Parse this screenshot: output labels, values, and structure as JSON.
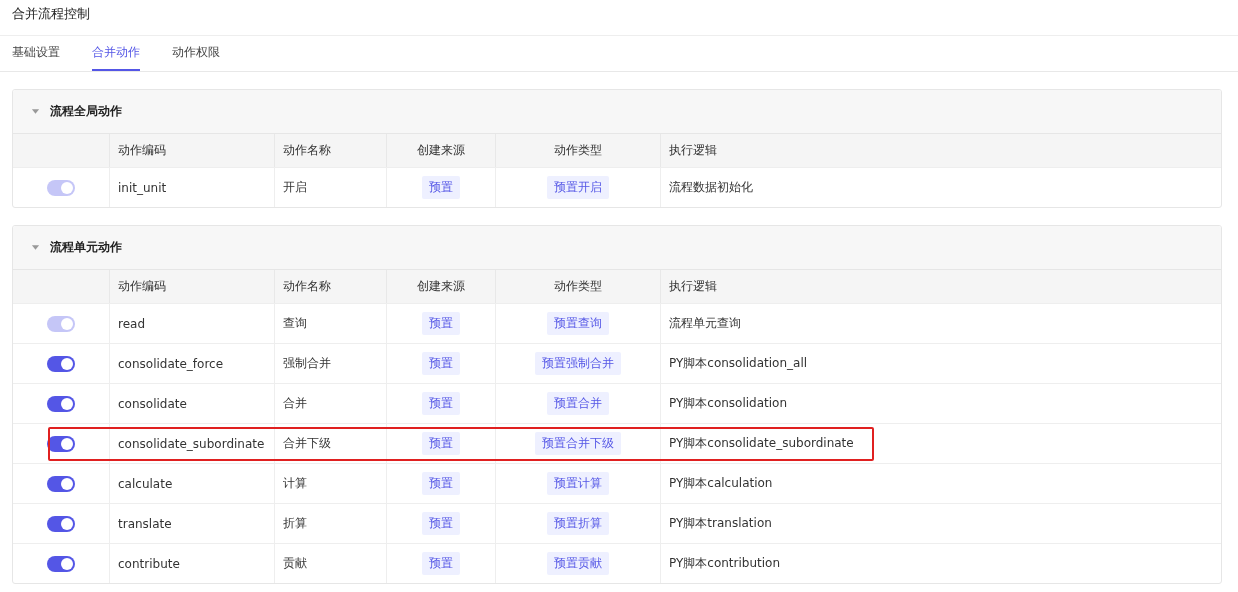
{
  "page_title": "合并流程控制",
  "tabs": [
    {
      "label": "基础设置",
      "selected": false
    },
    {
      "label": "合并动作",
      "selected": true
    },
    {
      "label": "动作权限",
      "selected": false
    }
  ],
  "sections": [
    {
      "title": "流程全局动作",
      "expanded": true,
      "columns": [
        "动作编码",
        "动作名称",
        "创建来源",
        "动作类型",
        "执行逻辑"
      ],
      "rows": [
        {
          "on": true,
          "disabled": true,
          "highlighted": false,
          "code": "init_unit",
          "name": "开启",
          "source": "预置",
          "type": "预置开启",
          "logic": "流程数据初始化"
        }
      ]
    },
    {
      "title": "流程单元动作",
      "expanded": true,
      "columns": [
        "动作编码",
        "动作名称",
        "创建来源",
        "动作类型",
        "执行逻辑"
      ],
      "rows": [
        {
          "on": true,
          "disabled": true,
          "highlighted": false,
          "code": "read",
          "name": "查询",
          "source": "预置",
          "type": "预置查询",
          "logic": "流程单元查询"
        },
        {
          "on": true,
          "disabled": false,
          "highlighted": false,
          "code": "consolidate_force",
          "name": "强制合并",
          "source": "预置",
          "type": "预置强制合并",
          "logic": "PY脚本consolidation_all"
        },
        {
          "on": true,
          "disabled": false,
          "highlighted": false,
          "code": "consolidate",
          "name": "合并",
          "source": "预置",
          "type": "预置合并",
          "logic": "PY脚本consolidation"
        },
        {
          "on": true,
          "disabled": false,
          "highlighted": true,
          "code": "consolidate_subordinate",
          "name": "合并下级",
          "source": "预置",
          "type": "预置合并下级",
          "logic": "PY脚本consolidate_subordinate"
        },
        {
          "on": true,
          "disabled": false,
          "highlighted": false,
          "code": "calculate",
          "name": "计算",
          "source": "预置",
          "type": "预置计算",
          "logic": "PY脚本calculation"
        },
        {
          "on": true,
          "disabled": false,
          "highlighted": false,
          "code": "translate",
          "name": "折算",
          "source": "预置",
          "type": "预置折算",
          "logic": "PY脚本translation"
        },
        {
          "on": true,
          "disabled": false,
          "highlighted": false,
          "code": "contribute",
          "name": "贡献",
          "source": "预置",
          "type": "预置贡献",
          "logic": "PY脚本contribution"
        }
      ]
    }
  ]
}
